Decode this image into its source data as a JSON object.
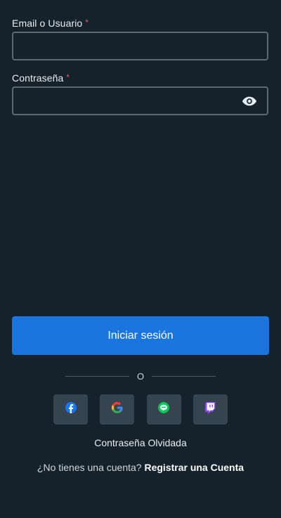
{
  "form": {
    "email_label": "Email o Usuario",
    "password_label": "Contraseña",
    "required_mark": "*",
    "email_value": "",
    "password_value": ""
  },
  "login_button": "Iniciar sesión",
  "divider_text": "O",
  "social_icons": [
    "facebook-icon",
    "google-icon",
    "line-icon",
    "twitch-icon"
  ],
  "forgot_password": "Contraseña Olvidada",
  "signup": {
    "prompt": "¿No tienes una cuenta?",
    "link": "Registrar una Cuenta"
  },
  "colors": {
    "background": "#15222c",
    "primary": "#1a76de",
    "required": "#e2566a",
    "social_button": "#35444e"
  }
}
